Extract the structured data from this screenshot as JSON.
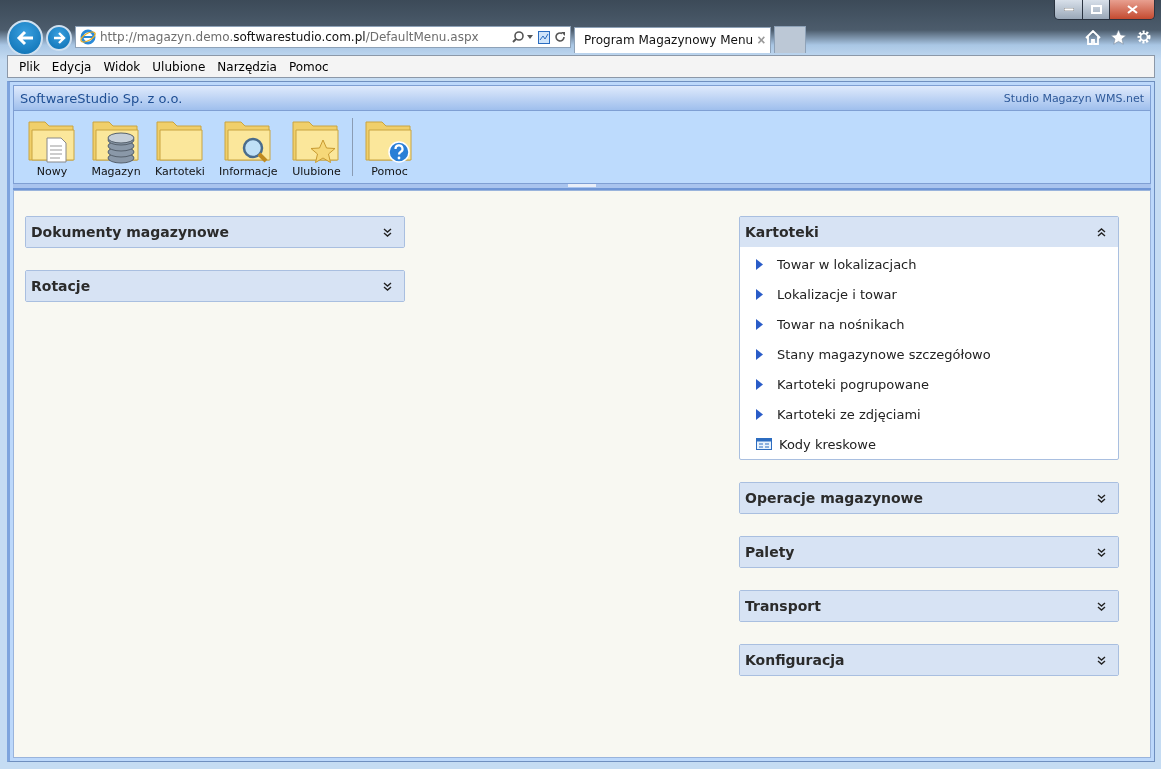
{
  "browser": {
    "address_prefix": "http://magazyn.demo.",
    "address_domain": "softwarestudio.com.pl",
    "address_path": "/DefaultMenu.aspx",
    "tab_title": "Program Magazynowy Menu",
    "tab_close": "×"
  },
  "menu_bar": [
    "Plik",
    "Edycja",
    "Widok",
    "Ulubione",
    "Narzędzia",
    "Pomoc"
  ],
  "app_header": {
    "company": "SoftwareStudio Sp. z o.o.",
    "product": "Studio Magazyn WMS.net"
  },
  "toolbar": [
    {
      "label": "Nowy",
      "kind": "document",
      "separator_before": false
    },
    {
      "label": "Magazyn",
      "kind": "database",
      "separator_before": false
    },
    {
      "label": "Kartoteki",
      "kind": "plain",
      "separator_before": false
    },
    {
      "label": "Informacje",
      "kind": "search",
      "separator_before": false
    },
    {
      "label": "Ulubione",
      "kind": "star",
      "separator_before": false
    },
    {
      "label": "Pomoc",
      "kind": "help",
      "separator_before": true
    }
  ],
  "left_panels": [
    {
      "title": "Dokumenty magazynowe",
      "expanded": false
    },
    {
      "title": "Rotacje",
      "expanded": false
    }
  ],
  "right_panels": [
    {
      "title": "Kartoteki",
      "expanded": true,
      "items": [
        {
          "label": "Towar w lokalizacjach",
          "kind": "arrow"
        },
        {
          "label": "Lokalizacje i towar",
          "kind": "arrow"
        },
        {
          "label": "Towar na nośnikach",
          "kind": "arrow"
        },
        {
          "label": "Stany magazynowe szczegółowo",
          "kind": "arrow"
        },
        {
          "label": "Kartoteki pogrupowane",
          "kind": "arrow"
        },
        {
          "label": "Kartoteki ze zdjęciami",
          "kind": "arrow"
        },
        {
          "label": "Kody kreskowe",
          "kind": "barcode"
        }
      ]
    },
    {
      "title": "Operacje magazynowe",
      "expanded": false
    },
    {
      "title": "Palety",
      "expanded": false
    },
    {
      "title": "Transport",
      "expanded": false
    },
    {
      "title": "Konfiguracja",
      "expanded": false
    }
  ]
}
